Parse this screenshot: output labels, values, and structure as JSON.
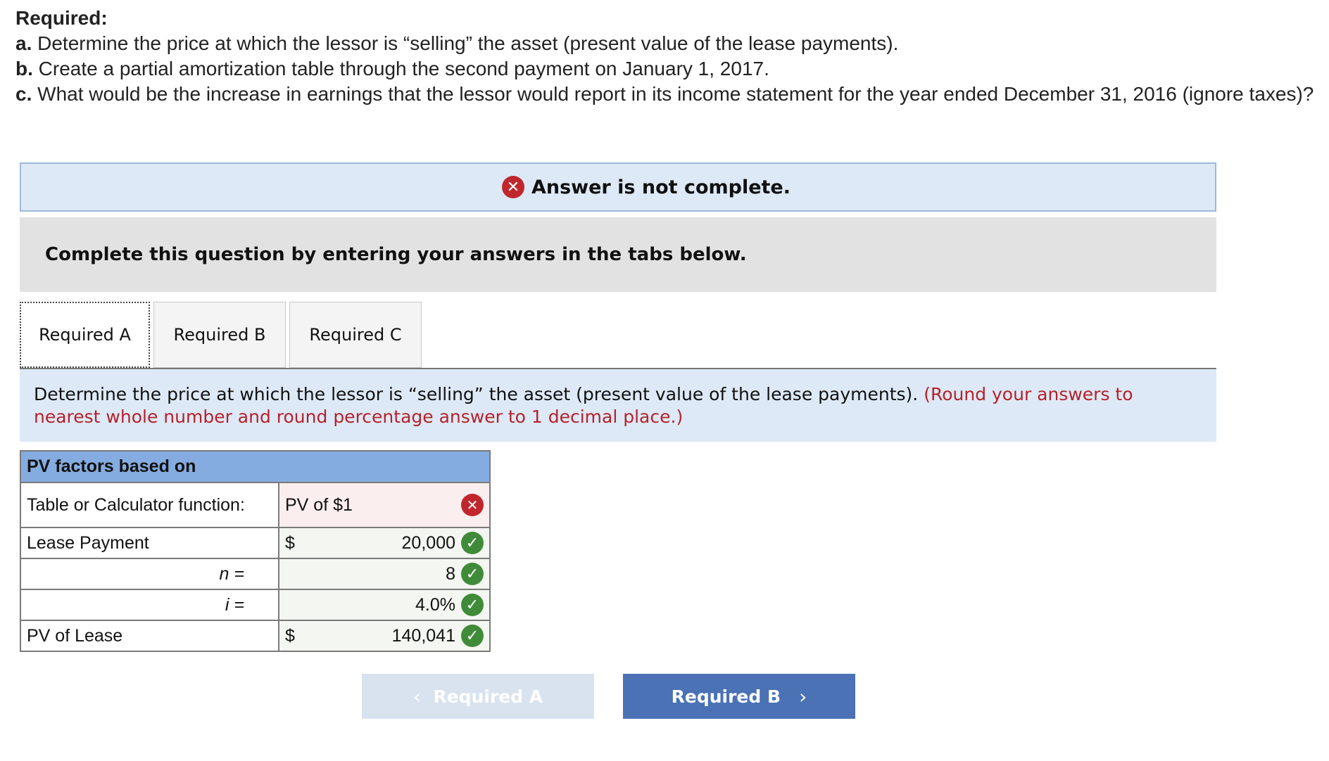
{
  "required": {
    "title": "Required:",
    "items": [
      {
        "letter": "a.",
        "text": " Determine the price at which the lessor is “selling” the asset (present value of the lease payments)."
      },
      {
        "letter": "b.",
        "text": " Create a partial amortization table through the second payment on January 1, 2017."
      },
      {
        "letter": "c.",
        "text": " What would be the increase in earnings that the lessor would report in its income statement for the year ended December 31, 2016 (ignore taxes)?"
      }
    ]
  },
  "banner": {
    "icon": "x-circle-icon",
    "text": "Answer is not complete.",
    "icon_color": "#c0272d"
  },
  "instruction": "Complete this question by entering your answers in the tabs below.",
  "tabs": [
    "Required A",
    "Required B",
    "Required C"
  ],
  "active_tab": "Required A",
  "prompt": {
    "text": "Determine the price at which the lessor is “selling” the asset (present value of the lease payments).",
    "note": "(Round your answers to nearest whole number and round percentage answer to 1 decimal place.)"
  },
  "table": {
    "header": "PV factors based on",
    "rows": [
      {
        "label": "Table or Calculator function:",
        "value": "PV of $1",
        "status": "incorrect"
      },
      {
        "label": "Lease Payment",
        "prefix": "$",
        "value": "20,000",
        "status": "correct"
      },
      {
        "label": "n =",
        "value": "8",
        "status": "correct"
      },
      {
        "label": "i =",
        "value": "4.0%",
        "status": "correct"
      },
      {
        "label": "PV of Lease",
        "prefix": "$",
        "value": "140,041",
        "status": "correct"
      }
    ]
  },
  "nav": {
    "prev_label": "Required A",
    "next_label": "Required B",
    "prev_icon": "chevron-left-icon",
    "next_icon": "chevron-right-icon"
  },
  "colors": {
    "correct": "#3f8b39",
    "incorrect": "#c0272d",
    "next_button": "#4a72b5",
    "header": "#85ace0"
  }
}
